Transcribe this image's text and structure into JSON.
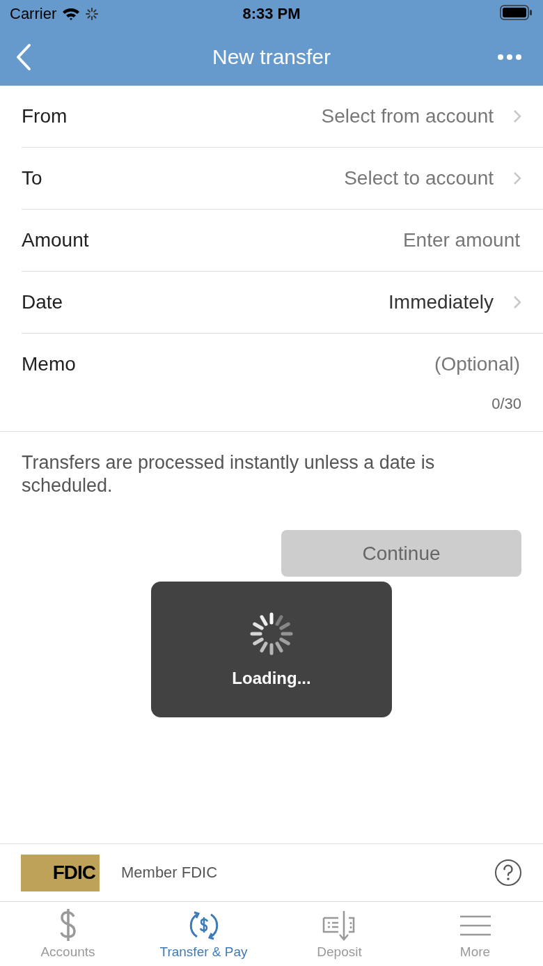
{
  "status_bar": {
    "carrier": "Carrier",
    "time": "8:33 PM"
  },
  "nav": {
    "title": "New transfer"
  },
  "fields": [
    {
      "kind": "select",
      "label": "From",
      "placeholder": "Select from account"
    },
    {
      "kind": "select",
      "label": "To",
      "placeholder": "Select to account"
    },
    {
      "kind": "input",
      "label": "Amount",
      "placeholder": "Enter amount"
    },
    {
      "kind": "select",
      "label": "Date",
      "value": "Immediately"
    },
    {
      "kind": "memo",
      "label": "Memo",
      "placeholder": "(Optional)",
      "counter": "0/30"
    }
  ],
  "note": "Transfers are processed instantly unless a date is scheduled.",
  "continue_button": {
    "label": "Continue",
    "disabled": true
  },
  "loading": {
    "text": "Loading..."
  },
  "footer": {
    "logo_text": "FDIC",
    "member": "Member FDIC"
  },
  "tabs": [
    {
      "label": "Accounts",
      "selected": false
    },
    {
      "label": "Transfer & Pay",
      "selected": true
    },
    {
      "label": "Deposit",
      "selected": false
    },
    {
      "label": "More",
      "selected": false
    }
  ]
}
